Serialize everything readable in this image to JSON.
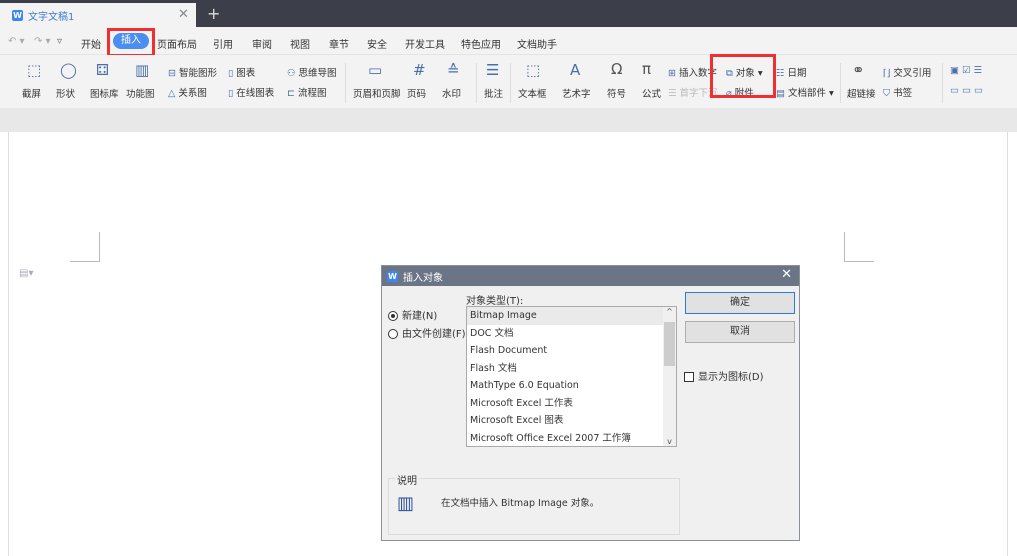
{
  "window": {
    "doc_tab": "文字文稿1",
    "logo": "W"
  },
  "menu": {
    "items": [
      "开始",
      "插入",
      "页面布局",
      "引用",
      "审阅",
      "视图",
      "章节",
      "安全",
      "开发工具",
      "特色应用",
      "文档助手"
    ]
  },
  "ribbon": {
    "screenshot": "截屏",
    "shape": "形状",
    "icon_lib": "图标库",
    "func_chart": "功能图",
    "smart_graphic": "智能图形",
    "chart": "图表",
    "mindmap": "思维导图",
    "relation": "关系图",
    "online_chart": "在线图表",
    "flowchart": "流程图",
    "header_footer": "页眉和页脚",
    "page_num": "页码",
    "watermark": "水印",
    "comment": "批注",
    "textbox": "文本框",
    "wordart": "艺术字",
    "symbol": "符号",
    "formula": "公式",
    "insert_number": "插入数字",
    "object": "对象",
    "date": "日期",
    "dropcap": "首字下沉",
    "attachment": "附件",
    "doc_parts": "文档部件",
    "hyperlink": "超链接",
    "cross_ref": "交叉引用",
    "bookmark": "书签"
  },
  "dialog": {
    "title": "插入对象",
    "new_label": "新建(N)",
    "from_file_label": "由文件创建(F)",
    "type_label": "对象类型(T):",
    "types": [
      "Bitmap Image",
      "DOC 文档",
      "Flash Document",
      "Flash 文档",
      "MathType 6.0 Equation",
      "Microsoft Excel 工作表",
      "Microsoft Excel 图表",
      "Microsoft Office Excel 2007 工作簿"
    ],
    "ok": "确定",
    "cancel": "取消",
    "show_icon": "显示为图标(D)",
    "desc_title": "说明",
    "desc_text": "在文档中插入 Bitmap Image 对象。"
  },
  "colors": {
    "accent": "#4a8ef0",
    "highlight": "#f03030"
  }
}
